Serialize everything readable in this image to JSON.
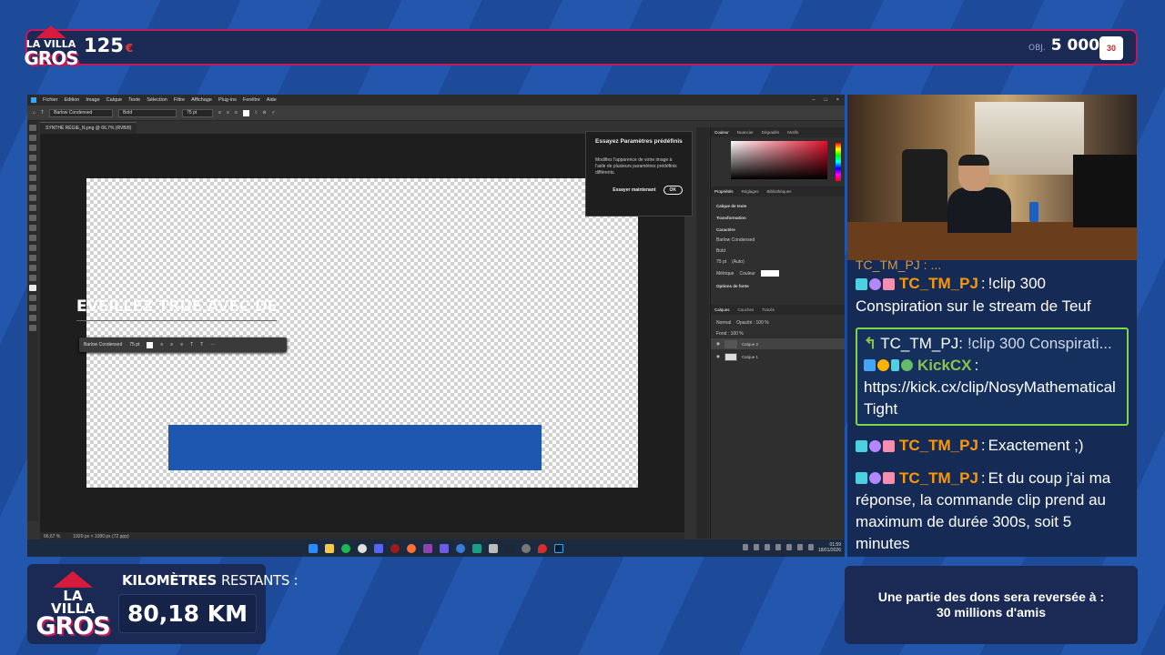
{
  "overlay": {
    "logo": {
      "line1": "LA VILLA",
      "line2": "GROS"
    },
    "counter_left": {
      "value": "125",
      "currency": "€"
    },
    "counter_right": {
      "label": "OBJ.",
      "value": "5 000",
      "currency": "€"
    },
    "sponsor_badge": "30",
    "km": {
      "label_bold": "KILOMÈTRES",
      "label_thin": "RESTANTS :",
      "value": "80,18 KM"
    },
    "donation": {
      "line1": "Une partie des dons sera reversée à :",
      "line2": "30 millions d'amis"
    }
  },
  "photoshop": {
    "menu": [
      "Fichier",
      "Edition",
      "Image",
      "Calque",
      "Texte",
      "Sélection",
      "Filtre",
      "Affichage",
      "Plug-ins",
      "Fenêtre",
      "Aide"
    ],
    "options": {
      "font": "Barlow Condensed",
      "style": "Bold",
      "size": "75 pt"
    },
    "doc_tab": "SYNTHÈ RÉGIE_N.png @ 66,7% (RVB/8)",
    "canvas_text": "EVEILLEZ TRUE AVEC DES",
    "float_bar": {
      "font": "Barlow Condensed",
      "size": "75 pt"
    },
    "popup": {
      "title": "Essayez Paramètres prédéfinis",
      "body": "Modifiez l'apparence de votre image à l'aide de plusieurs paramètres prédéfinis différents.",
      "try_label": "Essayer maintenant",
      "ok_label": "OK"
    },
    "status": {
      "zoom": "66,67 %",
      "size": "1920 px × 1080 px (72 ppp)"
    },
    "panels": {
      "color_tabs": [
        "Couleur",
        "Nuancier",
        "Dégradés",
        "Motifs"
      ],
      "prop_tabs": [
        "Propriétés",
        "Réglages",
        "Bibliothèques"
      ],
      "layer_type": "Calque de texte",
      "transform": "Transformation",
      "character": "Caractère",
      "char_font": "Barlow Condensed",
      "char_style": "Bold",
      "char_size": "75 pt",
      "leading": "(Auto)",
      "tracking": "Métrique",
      "color_label": "Couleur",
      "font_options": "Options de fonte",
      "layers_tabs": [
        "Calques",
        "Couches",
        "Tracés"
      ],
      "blend": "Normal",
      "opacity": "Opacité : 100 %",
      "fill": "Fond : 100 %",
      "layers": [
        "Calque 2",
        "Calque 1"
      ]
    },
    "taskbar_clock": {
      "time": "01:59",
      "date": "18/01/2026"
    }
  },
  "chat": {
    "cut_line": "TC_TM_PJ : ...",
    "messages": [
      {
        "user": "TC_TM_PJ",
        "text": "!clip 300 Conspiration sur le stream de Teuf"
      },
      {
        "reply_to": "TC_TM_PJ:",
        "reply_text": "!clip 300 Conspirati...",
        "user": "KickCX",
        "text": "https://kick.cx/clip/NosyMathematicalTight"
      },
      {
        "user": "TC_TM_PJ",
        "text": "Exactement ;)"
      },
      {
        "user": "TC_TM_PJ",
        "text": "Et du coup j'ai ma réponse, la commande clip prend au maximum de durée 300s, soit 5 minutes"
      }
    ]
  },
  "colors": {
    "accent": "#c2185b",
    "panel": "#1a2a55",
    "chat_bg": "#152a54",
    "name_orange": "#ff9800",
    "reply_border": "#7cd64b"
  }
}
